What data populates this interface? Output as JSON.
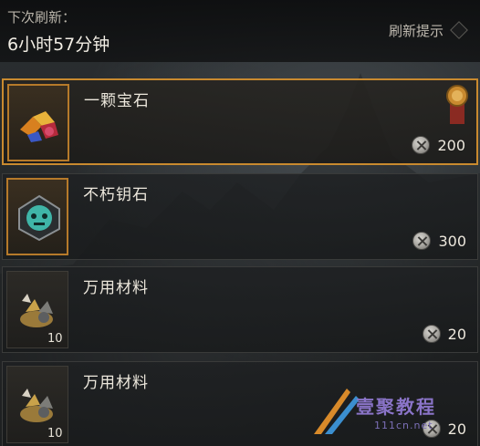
{
  "header": {
    "refresh_label": "下次刷新：",
    "refresh_time": "6小时57分钟",
    "refresh_hint": "刷新提示"
  },
  "items": [
    {
      "name": "一颗宝石",
      "icon": "gems-icon",
      "price": "200",
      "quantity": "",
      "selected": true,
      "badge": "medal-icon"
    },
    {
      "name": "不朽钥石",
      "icon": "keystone-icon",
      "price": "300",
      "quantity": "",
      "selected": false
    },
    {
      "name": "万用材料",
      "icon": "materials-icon",
      "price": "20",
      "quantity": "10",
      "selected": false
    },
    {
      "name": "万用材料",
      "icon": "materials-icon",
      "price": "20",
      "quantity": "10",
      "selected": false
    }
  ],
  "currency_icon": "platinum-coin-icon",
  "watermark": {
    "text": "壹聚教程",
    "url": "111cn.net"
  },
  "colors": {
    "selected_border": "#c98a2f",
    "text": "#ece7dc"
  }
}
